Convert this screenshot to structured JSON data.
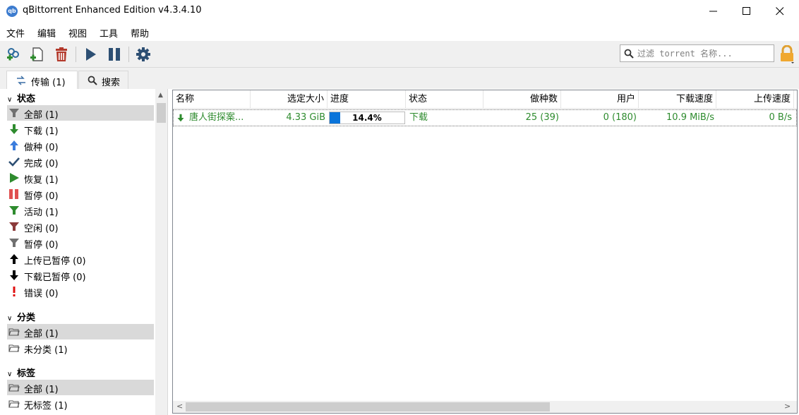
{
  "window": {
    "title": "qBittorrent Enhanced Edition v4.3.4.10",
    "icon_text": "qb"
  },
  "menu": [
    "文件",
    "编辑",
    "视图",
    "工具",
    "帮助"
  ],
  "search": {
    "placeholder": "过滤 torrent 名称..."
  },
  "tabs": [
    {
      "label": "传输 (1)"
    },
    {
      "label": "搜索"
    }
  ],
  "sidebar": {
    "status": {
      "title": "状态",
      "items": [
        {
          "label": "全部 (1)",
          "icon": "filter-all-icon",
          "color": "#707070"
        },
        {
          "label": "下载 (1)",
          "icon": "download-arrow-icon",
          "color": "#2e8b2e"
        },
        {
          "label": "做种 (0)",
          "icon": "upload-arrow-icon",
          "color": "#3b7ddd"
        },
        {
          "label": "完成 (0)",
          "icon": "checkmark-icon",
          "color": "#2d4f73"
        },
        {
          "label": "恢复 (1)",
          "icon": "resume-icon",
          "color": "#2e8b2e"
        },
        {
          "label": "暂停 (0)",
          "icon": "pause-icon",
          "color": "#e05050"
        },
        {
          "label": "活动 (1)",
          "icon": "filter-active-icon",
          "color": "#2e8b2e"
        },
        {
          "label": "空闲 (0)",
          "icon": "filter-inactive-icon",
          "color": "#8b3a3a"
        },
        {
          "label": "暂停 (0)",
          "icon": "filter-stalled-icon",
          "color": "#707070"
        },
        {
          "label": "上传已暂停 (0)",
          "icon": "upload-stalled-icon",
          "color": "#000000"
        },
        {
          "label": "下载已暂停 (0)",
          "icon": "download-stalled-icon",
          "color": "#000000"
        },
        {
          "label": "错误 (0)",
          "icon": "error-icon",
          "color": "#e01010"
        }
      ]
    },
    "categories": {
      "title": "分类",
      "items": [
        {
          "label": "全部 (1)"
        },
        {
          "label": "未分类 (1)"
        }
      ]
    },
    "tags": {
      "title": "标签",
      "items": [
        {
          "label": "全部 (1)"
        },
        {
          "label": "无标签 (1)"
        }
      ]
    }
  },
  "table": {
    "columns": [
      "名称",
      "选定大小",
      "进度",
      "状态",
      "做种数",
      "用户",
      "下载速度",
      "上传速度"
    ],
    "rows": [
      {
        "name": "唐人街探案...",
        "size": "4.33 GiB",
        "progress": 14.4,
        "progress_text": "14.4%",
        "status": "下载",
        "seeds": "25 (39)",
        "peers": "0 (180)",
        "down_speed": "10.9 MiB/s",
        "up_speed": "0 B/s"
      }
    ]
  },
  "colors": {
    "downloading_text": "#2e8b2e",
    "progress_fill": "#0a74da",
    "selection": "#d9d9d9"
  }
}
